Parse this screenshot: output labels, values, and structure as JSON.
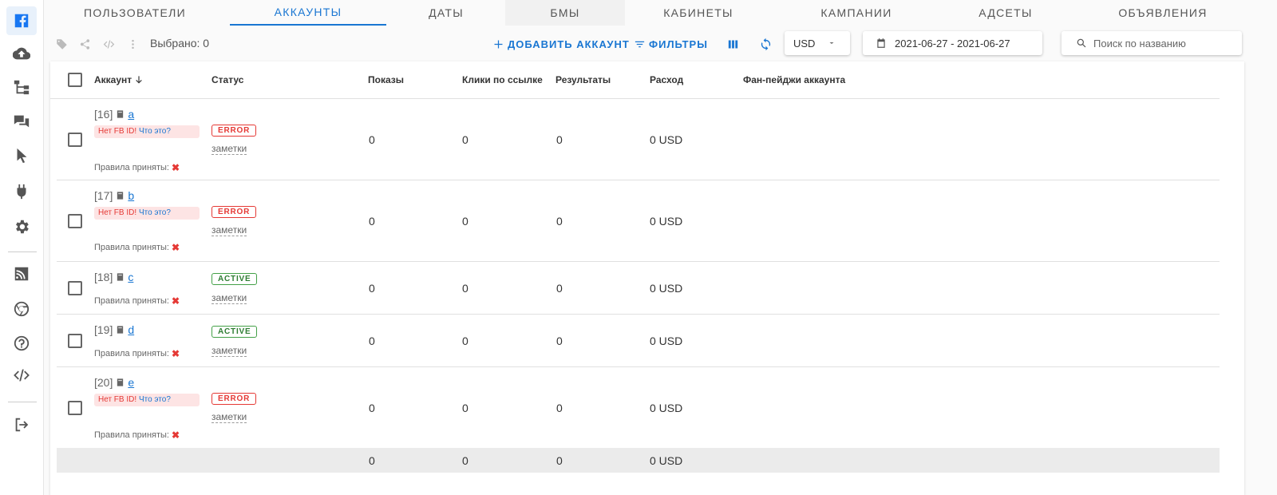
{
  "sidebar": {
    "items": [
      {
        "name": "facebook-icon",
        "active": true
      },
      {
        "name": "cloud-upload-icon"
      },
      {
        "name": "hierarchy-icon"
      },
      {
        "name": "chat-icon"
      },
      {
        "name": "cursor-icon"
      },
      {
        "name": "plug-icon"
      },
      {
        "name": "gear-icon"
      },
      {
        "name": "rss-icon"
      },
      {
        "name": "chrome-icon"
      },
      {
        "name": "help-icon"
      },
      {
        "name": "code-icon"
      },
      {
        "name": "logout-icon"
      }
    ]
  },
  "tabs": [
    "Пользователи",
    "Аккаунты",
    "Даты",
    "БМы",
    "Кабинеты",
    "Кампании",
    "Адсеты",
    "Объявления"
  ],
  "toolbar": {
    "selected": "Выбрано: 0",
    "add_account": "ДОБАВИТЬ АККАУНТ",
    "filters": "ФИЛЬТРЫ",
    "currency": "USD",
    "date_range": "2021-06-27 - 2021-06-27",
    "search_placeholder": "Поиск по названию"
  },
  "table": {
    "columns": {
      "account": "Аккаунт",
      "status": "Статус",
      "impressions": "Показы",
      "clicks": "Клики по ссылке",
      "results": "Результаты",
      "spend": "Расход",
      "fanpages": "Фан-пейджи аккаунта"
    },
    "no_fb_id": "Нет FB ID!",
    "what_is_it": "Что это?",
    "rules_label": "Правила приняты:",
    "notes_label": "заметки",
    "rows": [
      {
        "id": "[16]",
        "name": "a",
        "status": "ERROR",
        "impressions": "0",
        "clicks": "0",
        "results": "0",
        "spend": "0 USD"
      },
      {
        "id": "[17]",
        "name": "b",
        "status": "ERROR",
        "impressions": "0",
        "clicks": "0",
        "results": "0",
        "spend": "0 USD"
      },
      {
        "id": "[18]",
        "name": "c",
        "status": "ACTIVE",
        "impressions": "0",
        "clicks": "0",
        "results": "0",
        "spend": "0 USD"
      },
      {
        "id": "[19]",
        "name": "d",
        "status": "ACTIVE",
        "impressions": "0",
        "clicks": "0",
        "results": "0",
        "spend": "0 USD"
      },
      {
        "id": "[20]",
        "name": "e",
        "status": "ERROR",
        "impressions": "0",
        "clicks": "0",
        "results": "0",
        "spend": "0 USD"
      }
    ],
    "totals": {
      "impressions": "0",
      "clicks": "0",
      "results": "0",
      "spend": "0 USD"
    }
  }
}
